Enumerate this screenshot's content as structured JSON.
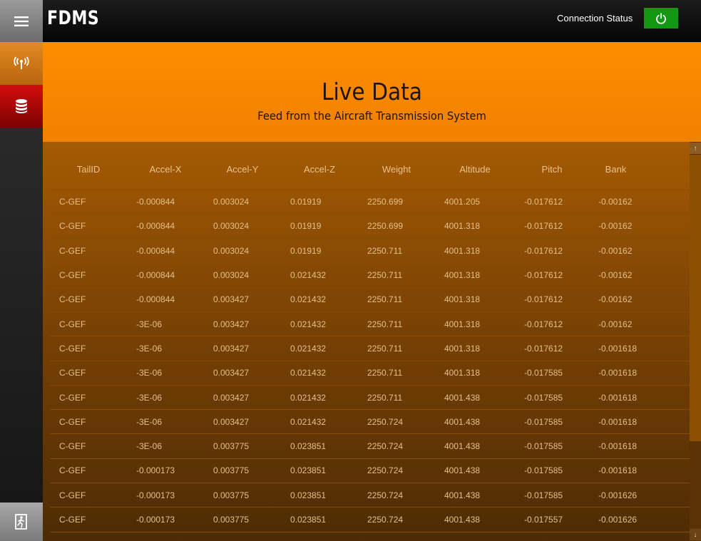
{
  "header": {
    "logo": "FDMS",
    "connection_label": "Connection Status",
    "connection_color": "#129812"
  },
  "sidebar": {
    "items": [
      {
        "name": "live-data",
        "icon": "broadcast-icon"
      },
      {
        "name": "database",
        "icon": "database-icon"
      },
      {
        "name": "exit",
        "icon": "exit-icon"
      }
    ]
  },
  "hero": {
    "title": "Live Data",
    "subtitle": "Feed from the Aircraft Transmission System"
  },
  "table": {
    "columns": [
      "TailID",
      "Accel-X",
      "Accel-Y",
      "Accel-Z",
      "Weight",
      "Altitude",
      "Pitch",
      "Bank"
    ],
    "rows": [
      [
        "C-GEF",
        "-0.000844",
        "0.003024",
        "0.01919",
        "2250.699",
        "4001.205",
        "-0.017612",
        "-0.00162"
      ],
      [
        "C-GEF",
        "-0.000844",
        "0.003024",
        "0.01919",
        "2250.699",
        "4001.318",
        "-0.017612",
        "-0.00162"
      ],
      [
        "C-GEF",
        "-0.000844",
        "0.003024",
        "0.01919",
        "2250.711",
        "4001.318",
        "-0.017612",
        "-0.00162"
      ],
      [
        "C-GEF",
        "-0.000844",
        "0.003024",
        "0.021432",
        "2250.711",
        "4001.318",
        "-0.017612",
        "-0.00162"
      ],
      [
        "C-GEF",
        "-0.000844",
        "0.003427",
        "0.021432",
        "2250.711",
        "4001.318",
        "-0.017612",
        "-0.00162"
      ],
      [
        "C-GEF",
        "-3E-06",
        "0.003427",
        "0.021432",
        "2250.711",
        "4001.318",
        "-0.017612",
        "-0.00162"
      ],
      [
        "C-GEF",
        "-3E-06",
        "0.003427",
        "0.021432",
        "2250.711",
        "4001.318",
        "-0.017612",
        "-0.001618"
      ],
      [
        "C-GEF",
        "-3E-06",
        "0.003427",
        "0.021432",
        "2250.711",
        "4001.318",
        "-0.017585",
        "-0.001618"
      ],
      [
        "C-GEF",
        "-3E-06",
        "0.003427",
        "0.021432",
        "2250.711",
        "4001.438",
        "-0.017585",
        "-0.001618"
      ],
      [
        "C-GEF",
        "-3E-06",
        "0.003427",
        "0.021432",
        "2250.724",
        "4001.438",
        "-0.017585",
        "-0.001618"
      ],
      [
        "C-GEF",
        "-3E-06",
        "0.003775",
        "0.023851",
        "2250.724",
        "4001.438",
        "-0.017585",
        "-0.001618"
      ],
      [
        "C-GEF",
        "-0.000173",
        "0.003775",
        "0.023851",
        "2250.724",
        "4001.438",
        "-0.017585",
        "-0.001618"
      ],
      [
        "C-GEF",
        "-0.000173",
        "0.003775",
        "0.023851",
        "2250.724",
        "4001.438",
        "-0.017585",
        "-0.001626"
      ],
      [
        "C-GEF",
        "-0.000173",
        "0.003775",
        "0.023851",
        "2250.724",
        "4001.438",
        "-0.017557",
        "-0.001626"
      ]
    ]
  }
}
